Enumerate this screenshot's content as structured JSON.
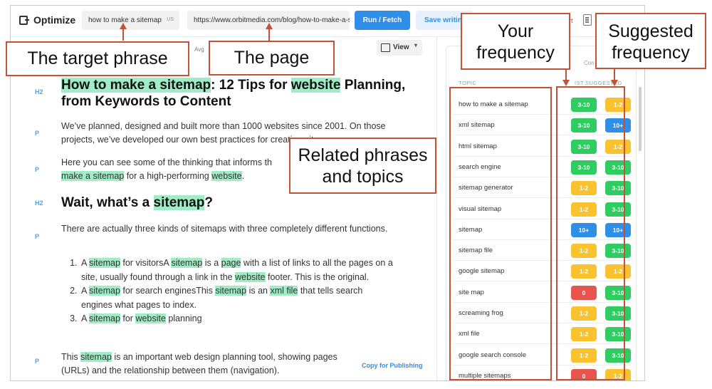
{
  "toolbar": {
    "app_name": "Optimize",
    "phrase_value": "how to make a sitemap",
    "phrase_flag": "US",
    "url_value": "https://www.orbitmedia.com/blog/how-to-make-a-sitemap/",
    "run_label": "Run / Fetch",
    "save_label": "Save writing",
    "export_label": "rt"
  },
  "subbar": {
    "avg_label": "Avg",
    "view_label": "View"
  },
  "editor": {
    "blocks": [
      {
        "tag": "H2",
        "text_parts": [
          "How to make a sitemap",
          ": 12 Tips for ",
          "website",
          " Planning, from Keywords to Content"
        ]
      },
      {
        "tag": "P",
        "text": "We’ve planned, designed and built more than 1000 websites since 2001. On those projects, we’ve developed our own best practices for creating sitemaps."
      },
      {
        "tag": "P",
        "text_parts": [
          "Here you can see some of the thinking that informs th",
          "make a sitemap",
          " for a high-performing ",
          "website",
          "."
        ]
      },
      {
        "tag": "H2",
        "text_parts": [
          "Wait, what’s a ",
          "sitemap",
          "?"
        ]
      },
      {
        "tag": "P",
        "text": "There are actually three kinds of sitemaps with three completely different functions."
      },
      {
        "tag": "P",
        "text_parts": [
          "This ",
          "sitemap",
          " is an important web design planning tool, showing pages (URLs) and the relationship between them (navigation)."
        ]
      }
    ],
    "list_items": [
      [
        "A ",
        "sitemap",
        " for visitorsA ",
        "sitemap",
        " is a ",
        "page",
        " with a list of links to all the pages on a site, usually found through a link in the ",
        "website",
        " footer. This is the original."
      ],
      [
        "A ",
        "sitemap",
        " for search enginesThis ",
        "sitemap",
        " is an ",
        "xml file",
        " that tells search engines what pages to index."
      ],
      [
        "A ",
        "sitemap",
        " for ",
        "website",
        " planning"
      ]
    ],
    "copy_label": "Copy for Publishing"
  },
  "panel": {
    "con_label": "Con",
    "col_topic": "TOPIC",
    "col_exist": "IST",
    "col_suggested": "SUGGESTED",
    "rows": [
      {
        "topic": "how to make a sitemap",
        "exist": "3-10",
        "exist_color": "green",
        "suggested": "1-2",
        "suggested_color": "yellow"
      },
      {
        "topic": "xml sitemap",
        "exist": "3-10",
        "exist_color": "green",
        "suggested": "10+",
        "suggested_color": "blue"
      },
      {
        "topic": "html sitemap",
        "exist": "3-10",
        "exist_color": "green",
        "suggested": "1-2",
        "suggested_color": "yellow"
      },
      {
        "topic": "search engine",
        "exist": "3-10",
        "exist_color": "green",
        "suggested": "3-10",
        "suggested_color": "green"
      },
      {
        "topic": "sitemap generator",
        "exist": "1-2",
        "exist_color": "yellow",
        "suggested": "3-10",
        "suggested_color": "green"
      },
      {
        "topic": "visual sitemap",
        "exist": "1-2",
        "exist_color": "yellow",
        "suggested": "3-10",
        "suggested_color": "green"
      },
      {
        "topic": "sitemap",
        "exist": "10+",
        "exist_color": "blue",
        "suggested": "10+",
        "suggested_color": "blue"
      },
      {
        "topic": "sitemap file",
        "exist": "1-2",
        "exist_color": "yellow",
        "suggested": "3-10",
        "suggested_color": "green"
      },
      {
        "topic": "google sitemap",
        "exist": "1-2",
        "exist_color": "yellow",
        "suggested": "1-2",
        "suggested_color": "yellow"
      },
      {
        "topic": "site map",
        "exist": "0",
        "exist_color": "red",
        "suggested": "3-10",
        "suggested_color": "green"
      },
      {
        "topic": "screaming frog",
        "exist": "1-2",
        "exist_color": "yellow",
        "suggested": "3-10",
        "suggested_color": "green"
      },
      {
        "topic": "xml file",
        "exist": "1-2",
        "exist_color": "yellow",
        "suggested": "3-10",
        "suggested_color": "green"
      },
      {
        "topic": "google search console",
        "exist": "1-2",
        "exist_color": "yellow",
        "suggested": "3-10",
        "suggested_color": "green"
      },
      {
        "topic": "multiple sitemaps",
        "exist": "0",
        "exist_color": "red",
        "suggested": "1-2",
        "suggested_color": "yellow"
      }
    ]
  },
  "annotations": {
    "target_phrase": "The target phrase",
    "the_page": "The page",
    "related": "Related phrases and topics",
    "your_frequency": "Your frequency",
    "suggested_frequency": "Suggested frequency"
  },
  "colors": {
    "accent": "#2f8fe8",
    "highlight": "#9fecc5",
    "callout_border": "#c0533a",
    "green": "#2ecc61",
    "yellow": "#f9c22e",
    "blue": "#2f8fe8",
    "red": "#e8554e"
  }
}
